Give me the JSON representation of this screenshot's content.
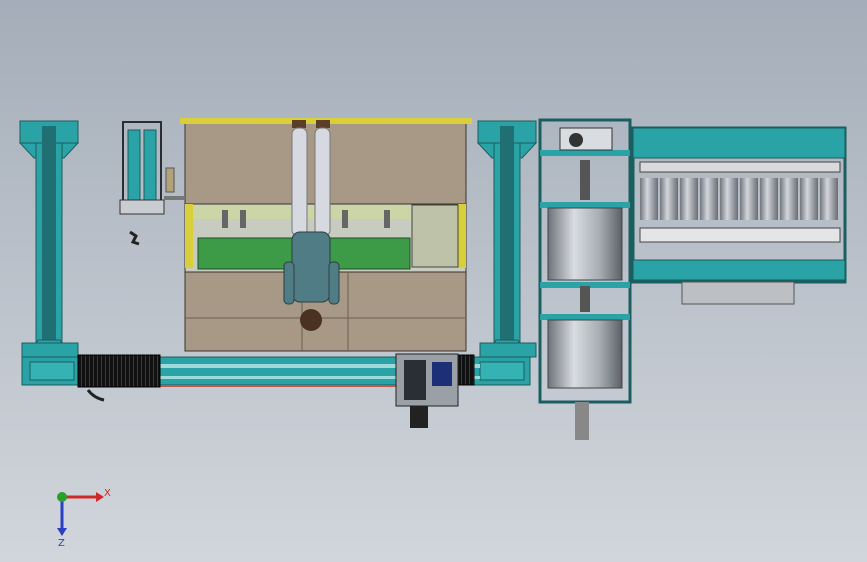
{
  "viewport": {
    "background_top": "#a4adb9",
    "background_bottom": "#d2d6dc"
  },
  "triad": {
    "x_label": "X",
    "z_label": "Z",
    "x_color": "#d02828",
    "z_color": "#2a3fc4",
    "y_color": "#2aa02a"
  },
  "colors": {
    "teal": "#2aa3a6",
    "dark_teal": "#1f6f73",
    "plate": "#a89886",
    "green_panel": "#3d9a47",
    "yellow": "#d9cf3a",
    "steel": "#a7acb3"
  },
  "icons": [
    "human-figure-icon",
    "axis-triad-icon"
  ]
}
